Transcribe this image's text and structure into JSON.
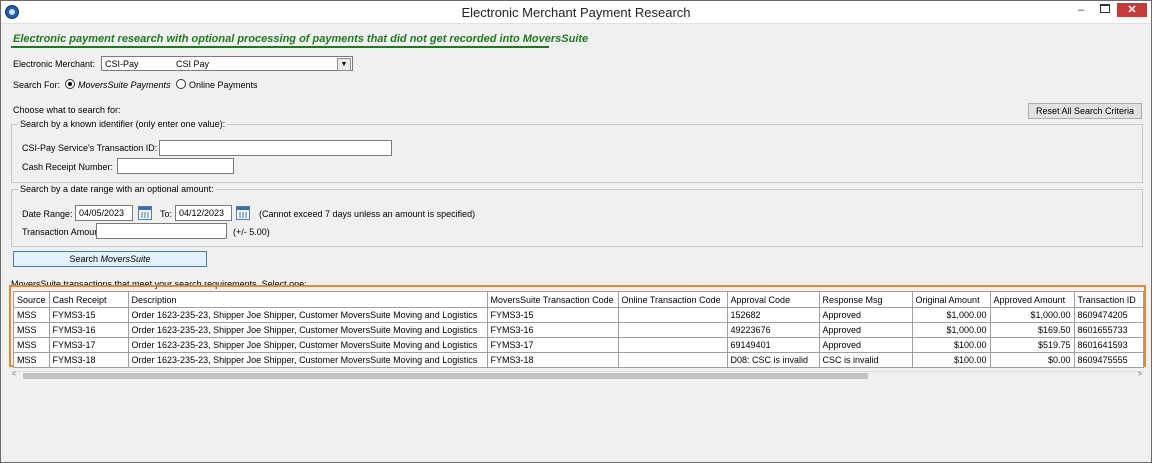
{
  "window": {
    "title": "Electronic Merchant Payment Research",
    "minimize_label": "–",
    "close_label": "✕"
  },
  "headline": "Electronic payment research with optional processing of payments that did not get recorded into MoversSuite",
  "merchant": {
    "label": "Electronic Merchant:",
    "selected_code": "CSI-Pay",
    "selected_name": "CSI Pay"
  },
  "search_for": {
    "label": "Search For:",
    "options": [
      {
        "label": "MoversSuite Payments",
        "selected": true
      },
      {
        "label": "Online Payments",
        "selected": false
      }
    ]
  },
  "choose_label": "Choose what to search for:",
  "reset_button": "Reset All Search Criteria",
  "identifier_group": {
    "title": "Search by a known identifier (only enter one value):",
    "transaction_id_label": "CSI-Pay Service's Transaction ID:",
    "transaction_id_value": "",
    "cash_receipt_label": "Cash Receipt Number:",
    "cash_receipt_value": ""
  },
  "date_group": {
    "title": "Search by a date range with an optional amount:",
    "date_range_label": "Date Range:",
    "from_date": "04/05/2023",
    "to_label": "To:",
    "to_date": "04/12/2023",
    "date_note": "(Cannot exceed 7 days unless an amount is specified)",
    "amount_label": "Transaction Amount:",
    "amount_value": "",
    "amount_note": "(+/- 5.00)"
  },
  "search_button": {
    "prefix": "Search ",
    "emphasis": "MoversSuite"
  },
  "results_label": "MoversSuite transactions that meet your search requirements.  Select one:",
  "grid": {
    "columns": [
      "Source",
      "Cash Receipt",
      "Description",
      "MoversSuite Transaction Code",
      "Online Transaction Code",
      "Approval Code",
      "Response Msg",
      "Original Amount",
      "Approved Amount",
      "Transaction ID"
    ],
    "rows": [
      {
        "source": "MSS",
        "cash_receipt": "FYMS3-15",
        "description": "Order 1623-235-23, Shipper Joe Shipper, Customer MoversSuite Moving and Logistics",
        "ms_code": "FYMS3-15",
        "online_code": "",
        "approval": "152682",
        "response": "Approved",
        "original": "$1,000.00",
        "approved": "$1,000.00",
        "transaction_id": "8609474205"
      },
      {
        "source": "MSS",
        "cash_receipt": "FYMS3-16",
        "description": "Order 1623-235-23, Shipper Joe Shipper, Customer MoversSuite Moving and Logistics",
        "ms_code": "FYMS3-16",
        "online_code": "",
        "approval": "49223676",
        "response": "Approved",
        "original": "$1,000.00",
        "approved": "$169.50",
        "transaction_id": "8601655733"
      },
      {
        "source": "MSS",
        "cash_receipt": "FYMS3-17",
        "description": "Order 1623-235-23, Shipper Joe Shipper, Customer MoversSuite Moving and Logistics",
        "ms_code": "FYMS3-17",
        "online_code": "",
        "approval": "69149401",
        "response": "Approved",
        "original": "$100.00",
        "approved": "$519.75",
        "transaction_id": "8601641593"
      },
      {
        "source": "MSS",
        "cash_receipt": "FYMS3-18",
        "description": "Order 1623-235-23, Shipper Joe Shipper, Customer MoversSuite Moving and Logistics",
        "ms_code": "FYMS3-18",
        "online_code": "",
        "approval": "D08: CSC is invalid",
        "response": "CSC is invalid",
        "original": "$100.00",
        "approved": "$0.00",
        "transaction_id": "8609475555"
      }
    ]
  },
  "colors": {
    "headline_green": "#1f7a1f",
    "highlight_orange": "#e8882f",
    "window_bg": "#f0f0f0"
  },
  "icons": {
    "app": "app-logo-icon",
    "calendar": "calendar-icon",
    "dropdown": "chevron-down-icon"
  }
}
